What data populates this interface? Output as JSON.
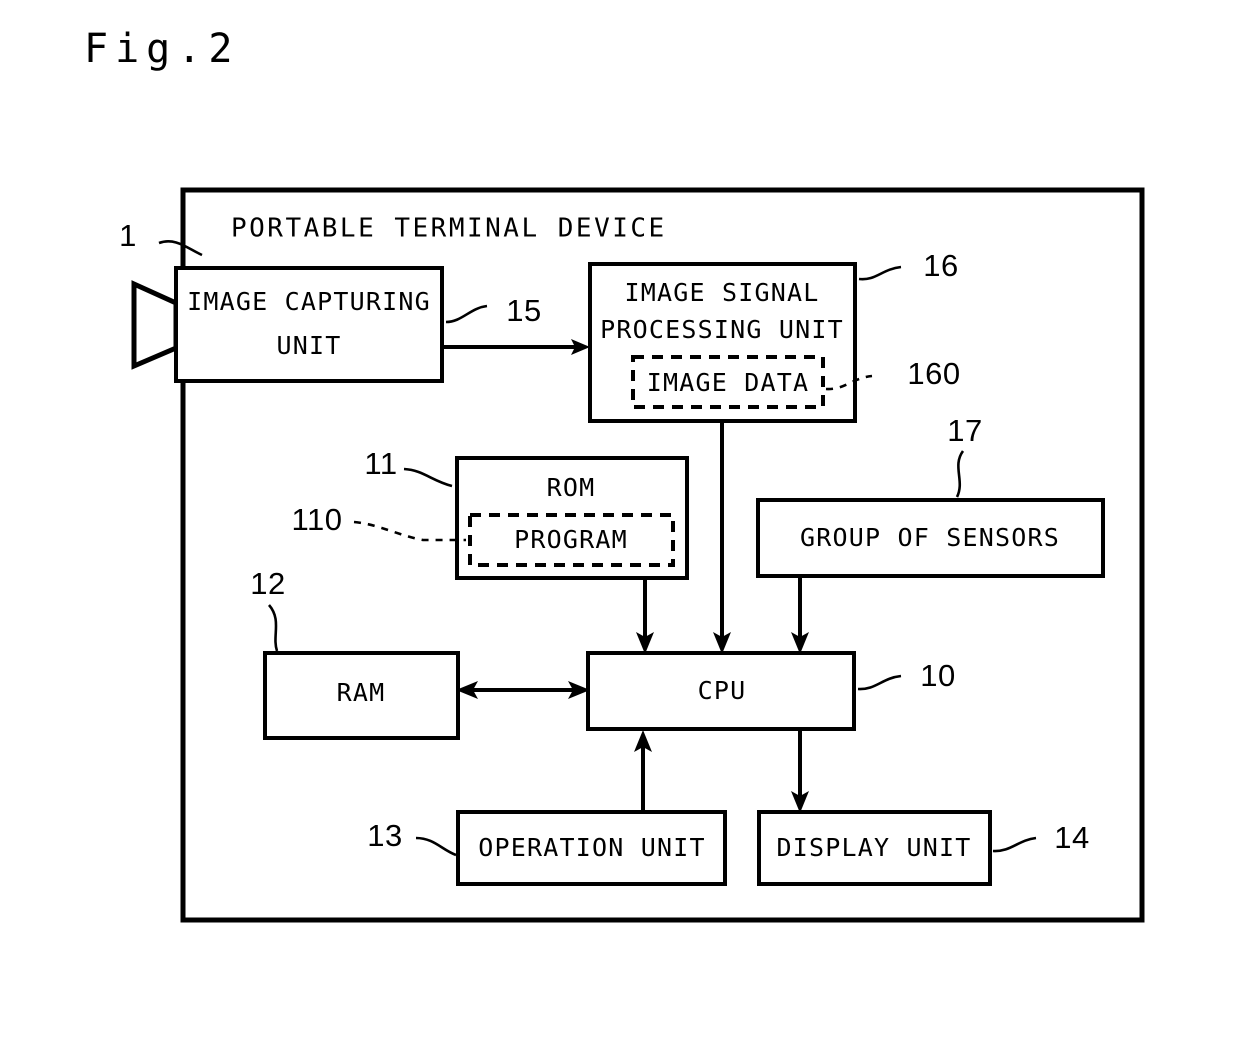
{
  "figure": {
    "title": "Fig.2",
    "device_title": "PORTABLE TERMINAL DEVICE",
    "device_ref": "1"
  },
  "blocks": {
    "image_capturing_unit": {
      "line1": "IMAGE CAPTURING",
      "line2": "UNIT",
      "ref": ""
    },
    "image_signal_processing_unit": {
      "line1": "IMAGE SIGNAL",
      "line2": "PROCESSING UNIT",
      "ref": "16",
      "inner": {
        "label": "IMAGE DATA",
        "ref": "160"
      }
    },
    "rom": {
      "label": "ROM",
      "ref": "11",
      "inner": {
        "label": "PROGRAM",
        "ref": "110"
      }
    },
    "group_of_sensors": {
      "label": "GROUP OF SENSORS",
      "ref": "17"
    },
    "ram": {
      "label": "RAM",
      "ref": "12"
    },
    "cpu": {
      "label": "CPU",
      "ref": "10"
    },
    "operation_unit": {
      "label": "OPERATION UNIT",
      "ref": "13"
    },
    "display_unit": {
      "label": "DISPLAY UNIT",
      "ref": "14"
    }
  },
  "connections": {
    "capture_to_isp_ref": "15"
  },
  "colors": {
    "ink": "#000000",
    "paper": "#ffffff"
  }
}
